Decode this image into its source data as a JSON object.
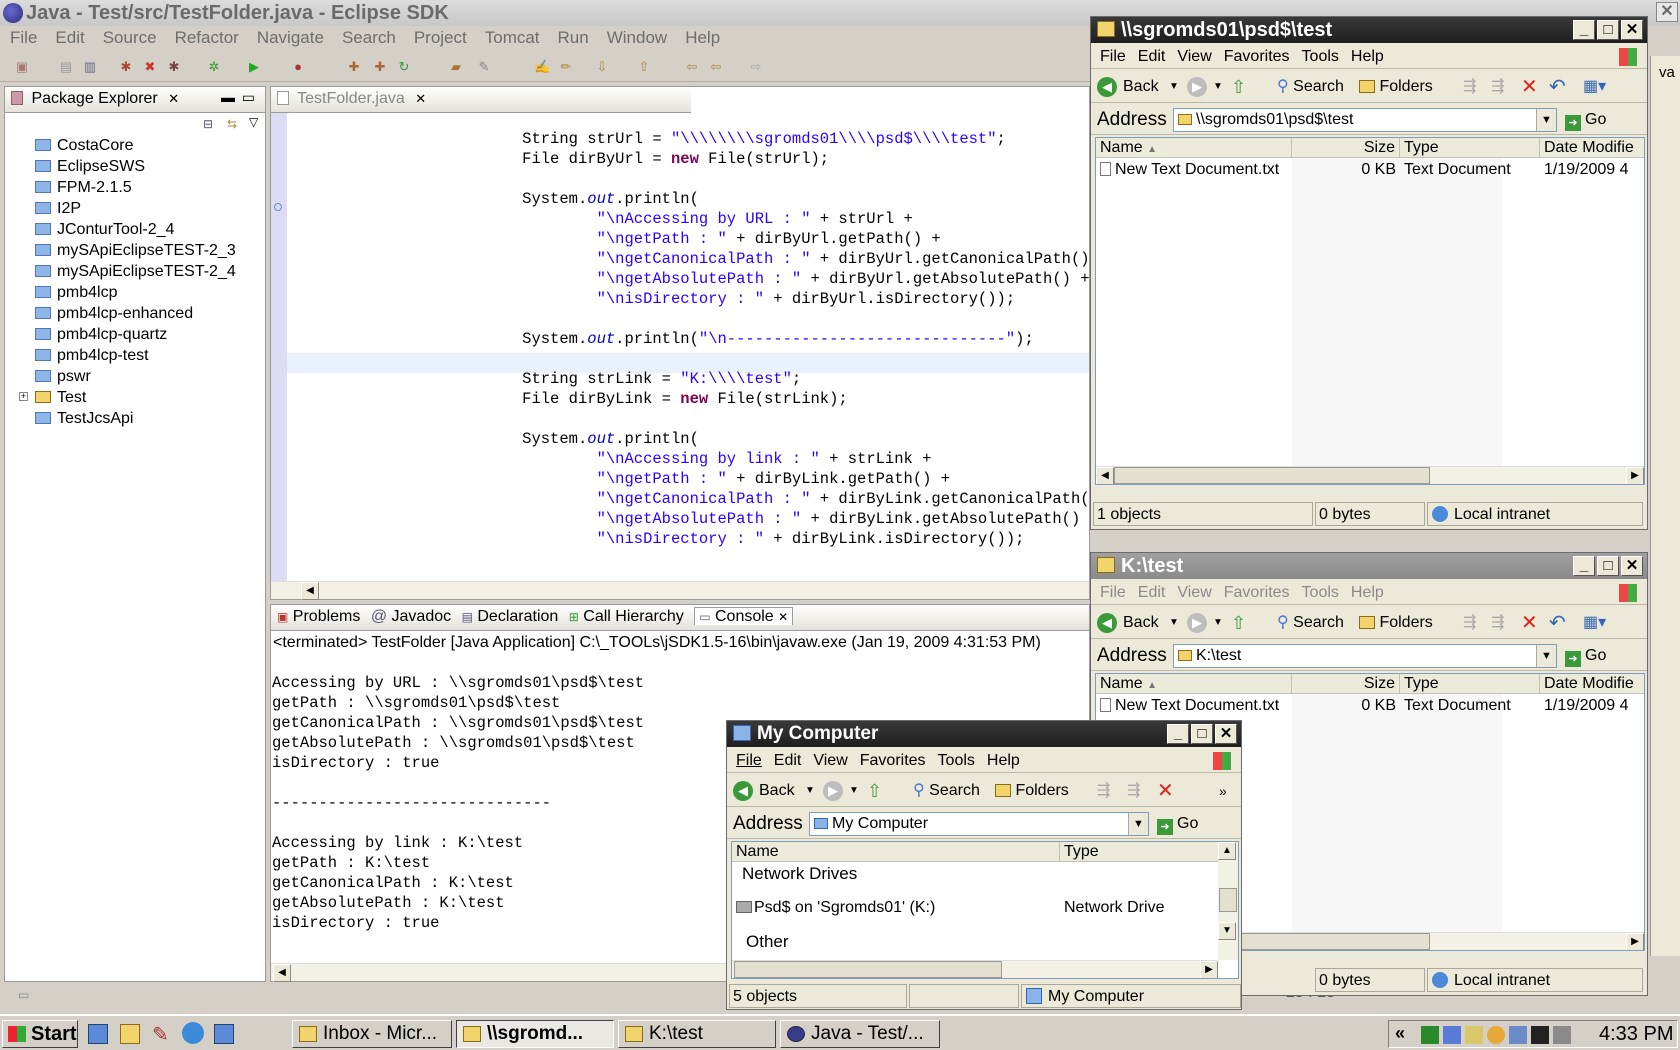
{
  "eclipse": {
    "title": "Java - Test/src/TestFolder.java - Eclipse SDK",
    "menu": [
      "File",
      "Edit",
      "Source",
      "Refactor",
      "Navigate",
      "Search",
      "Project",
      "Tomcat",
      "Run",
      "Window",
      "Help"
    ],
    "package_explorer": {
      "tab": "Package Explorer",
      "items": [
        "CostaCore",
        "EclipseSWS",
        "FPM-2.1.5",
        "I2P",
        "JConturTool-2_4",
        "mySApiEclipseTEST-2_3",
        "mySApiEclipseTEST-2_4",
        "pmb4lcp",
        "pmb4lcp-enhanced",
        "pmb4lcp-quartz",
        "pmb4lcp-test",
        "pswr",
        "Test",
        "TestJcsApi"
      ]
    },
    "editor_tab": "TestFolder.java",
    "bottom_tabs": [
      "Problems",
      "Javadoc",
      "Declaration",
      "Call Hierarchy",
      "Console"
    ],
    "console_header": "<terminated> TestFolder [Java Application] C:\\_TOOLs\\jSDK1.5-16\\bin\\javaw.exe (Jan 19, 2009 4:31:53 PM)",
    "console_lines": [
      "Accessing by URL : \\\\sgromds01\\psd$\\test",
      "getPath : \\\\sgromds01\\psd$\\test",
      "getCanonicalPath : \\\\sgromds01\\psd$\\test",
      "getAbsolutePath : \\\\sgromds01\\psd$\\test",
      "isDirectory : true",
      "",
      "------------------------------",
      "",
      "Accessing by link : K:\\test",
      "getPath : K:\\test",
      "getCanonicalPath : K:\\test",
      "getAbsolutePath : K:\\test",
      "isDirectory : true"
    ],
    "status_position": "25 : 13"
  },
  "explorer_unc": {
    "title": "\\\\sgromds01\\psd$\\test",
    "menu": [
      "File",
      "Edit",
      "View",
      "Favorites",
      "Tools",
      "Help"
    ],
    "back": "Back",
    "search": "Search",
    "folders": "Folders",
    "address_label": "Address",
    "address": "\\\\sgromds01\\psd$\\test",
    "go": "Go",
    "columns": [
      "Name",
      "Size",
      "Type",
      "Date Modifie"
    ],
    "file": {
      "name": "New Text Document.txt",
      "size": "0 KB",
      "type": "Text Document",
      "date": "1/19/2009 4"
    },
    "status": [
      "1 objects",
      "0 bytes",
      "Local intranet"
    ]
  },
  "explorer_k": {
    "title": "K:\\test",
    "menu": [
      "File",
      "Edit",
      "View",
      "Favorites",
      "Tools",
      "Help"
    ],
    "back": "Back",
    "search": "Search",
    "folders": "Folders",
    "address_label": "Address",
    "address": "K:\\test",
    "go": "Go",
    "columns": [
      "Name",
      "Size",
      "Type",
      "Date Modifie"
    ],
    "file": {
      "name": "New Text Document.txt",
      "size": "0 KB",
      "type": "Text Document",
      "date": "1/19/2009 4"
    },
    "status": [
      "0 bytes",
      "Local intranet"
    ]
  },
  "my_computer": {
    "title": "My Computer",
    "menu": [
      "File",
      "Edit",
      "View",
      "Favorites",
      "Tools",
      "Help"
    ],
    "back": "Back",
    "search": "Search",
    "folders": "Folders",
    "address_label": "Address",
    "address": "My Computer",
    "go": "Go",
    "columns": [
      "Name",
      "Type"
    ],
    "group1": "Network Drives",
    "drive_name": "Psd$ on 'Sgromds01' (K:)",
    "drive_type": "Network Drive",
    "group2": "Other",
    "status": [
      "5 objects",
      "My Computer"
    ]
  },
  "taskbar": {
    "start": "Start",
    "tasks": [
      "Inbox - Micr...",
      "\\\\sgromd...",
      "K:\\test",
      "Java - Test/..."
    ],
    "clock": "4:33 PM"
  }
}
